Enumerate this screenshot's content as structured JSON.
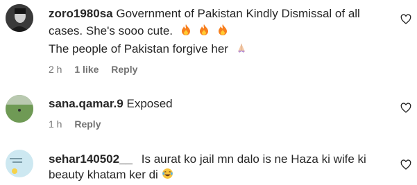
{
  "comments": [
    {
      "username": "zoro1980sa",
      "text_line1": "Government of Pakistan Kindly Dismissal of all",
      "text_line2": "cases. She's sooo cute.",
      "text_line3": "The people of Pakistan forgive her",
      "emoji_line2": [
        "fire-emoji",
        "fire-emoji",
        "fire-emoji"
      ],
      "emoji_line3": "praying-hands-emoji",
      "time": "2 h",
      "likes": "1 like",
      "reply": "Reply",
      "avatar_icon": "profile-photo-dark"
    },
    {
      "username": "sana.qamar.9",
      "text_line1": "Exposed",
      "time": "1 h",
      "reply": "Reply",
      "avatar_icon": "profile-photo-field"
    },
    {
      "username": "sehar140502__",
      "text_line1": "Is aurat ko jail mn dalo is ne Haza ki wife ki",
      "text_line2": "beauty khatam ker di",
      "emoji_line2": "laughing-tears-emoji",
      "avatar_icon": "profile-photo-light"
    }
  ],
  "colors": {
    "text": "#262626",
    "muted": "#737373",
    "fire": "#f77f1e"
  }
}
